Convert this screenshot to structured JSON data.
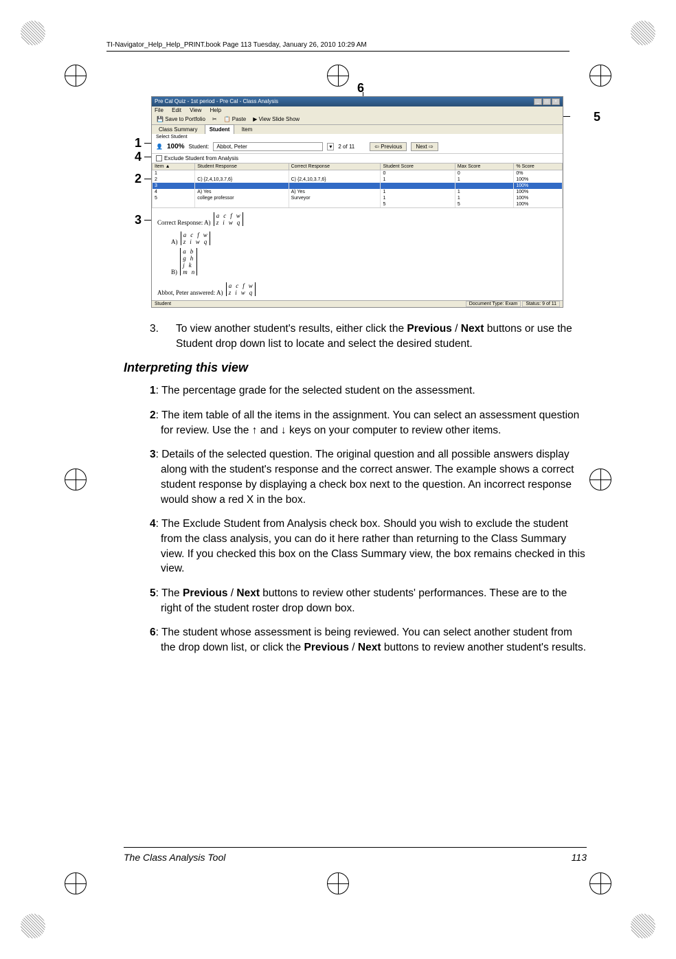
{
  "header": "TI-Navigator_Help_Help_PRINT.book  Page 113  Tuesday, January 26, 2010  10:29 AM",
  "screenshot": {
    "title": "Pre Cal Quiz - 1st period - Pre Cal - Class Analysis",
    "menus": [
      "File",
      "Edit",
      "View",
      "Help"
    ],
    "toolbar": [
      "Save to Portfolio",
      "Paste",
      "View Slide Show"
    ],
    "tabs": {
      "t1": "Class Summary",
      "t2": "Student",
      "t3": "Item"
    },
    "select_label": "Select Student",
    "percent": "100%",
    "student_label": "Student:",
    "student_value": "Abbot, Peter",
    "counter": "2 of 11",
    "prev": "Previous",
    "next": "Next",
    "exclude": "Exclude Student from Analysis",
    "cols": {
      "item": "Item",
      "resp": "Student Response",
      "correct": "Correct Response",
      "sscore": "Student Score",
      "mscore": "Max Score",
      "pct": "% Score"
    },
    "rows": [
      {
        "item": "1",
        "resp": "",
        "correct": "",
        "sscore": "0",
        "mscore": "0",
        "pct": "0%"
      },
      {
        "item": "2",
        "resp": "C) {2,4,10,3.7,6}",
        "correct": "C) {2,4,10,3.7,6}",
        "sscore": "1",
        "mscore": "1",
        "pct": "100%"
      },
      {
        "item": "3",
        "resp": "",
        "correct": "",
        "sscore": "",
        "mscore": "",
        "pct": "100%",
        "hl": true
      },
      {
        "item": "4",
        "resp": "A) Yes",
        "correct": "A) Yes",
        "sscore": "1",
        "mscore": "1",
        "pct": "100%"
      },
      {
        "item": "5",
        "resp": "college professor",
        "correct": "Surveyor",
        "sscore": "1",
        "mscore": "1",
        "pct": "100%"
      },
      {
        "item": "",
        "resp": "",
        "correct": "",
        "sscore": "5",
        "mscore": "5",
        "pct": "100%"
      }
    ],
    "detail": {
      "correct_label": "Correct Response: A)",
      "answered": "Abbot, Peter answered:  A)"
    },
    "status": {
      "left": "Student",
      "doc": "Document Type: Exam",
      "right": "Status: 9 of 11"
    }
  },
  "callouts": {
    "c1": "1",
    "c2": "2",
    "c3": "3",
    "c4": "4",
    "c5": "5",
    "c6": "6"
  },
  "step3": {
    "num": "3.",
    "text_a": "To view another student's results, either click the ",
    "prev": "Previous",
    "slash": " / ",
    "next": "Next",
    "text_b": " buttons or use the Student drop down list to locate and select the desired student."
  },
  "section": "Interpreting this view",
  "d1": {
    "n": "1",
    "t": ": The percentage grade for the selected student on the assessment."
  },
  "d2": {
    "n": "2",
    "t": ": The item table of all the items in the assignment. You can select an assessment question for review. Use the ↑ and ↓ keys on your computer to review other items."
  },
  "d3": {
    "n": "3",
    "t": ": Details of the selected question. The original question and all possible answers display along with the student's response and the correct answer. The example shows a correct student response by displaying a check box next to the question. An incorrect response would show a red X in the box."
  },
  "d4": {
    "n": "4",
    "t": ": The Exclude Student from Analysis check box. Should you wish to exclude the student from the class analysis, you can do it here rather than returning to the Class Summary view. If you checked this box on the Class Summary view, the box remains checked in this view."
  },
  "d5": {
    "n": "5",
    "a": ": The ",
    "prev": "Previous",
    "slash": " / ",
    "next": "Next",
    "b": " buttons to review other students' performances. These are to the right of the student roster drop down box."
  },
  "d6": {
    "n": "6",
    "a": ": The student whose assessment is being reviewed. You can select another student from the drop down list, or click the ",
    "prev": "Previous",
    "slash": " / ",
    "next": "Next",
    "b": " buttons to review another student's results."
  },
  "footer": {
    "title": "The Class Analysis Tool",
    "page": "113"
  }
}
